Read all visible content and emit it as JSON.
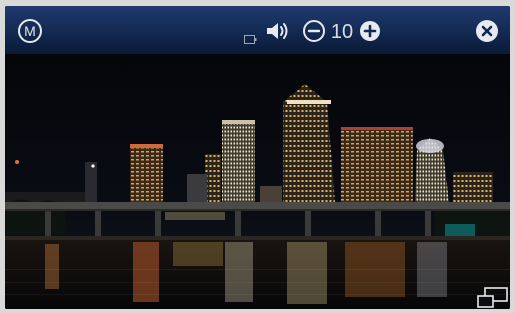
{
  "topbar": {
    "mode_button": {
      "label": "M",
      "icon": "mode-icon"
    },
    "battery_icon": "battery-icon",
    "speaker_icon": "speaker-volume-icon",
    "volume_down_icon": "minus-circle-icon",
    "volume_value": "10",
    "volume_up_icon": "plus-circle-icon",
    "close_icon": "close-circle-icon"
  },
  "photo": {
    "icon": "city-night-photo"
  },
  "overlay": {
    "pip_icon": "picture-in-picture-icon"
  },
  "colors": {
    "bar_top": "#1f3a70",
    "bar_bottom": "#0a1a38",
    "icon": "#e6e9ef"
  }
}
